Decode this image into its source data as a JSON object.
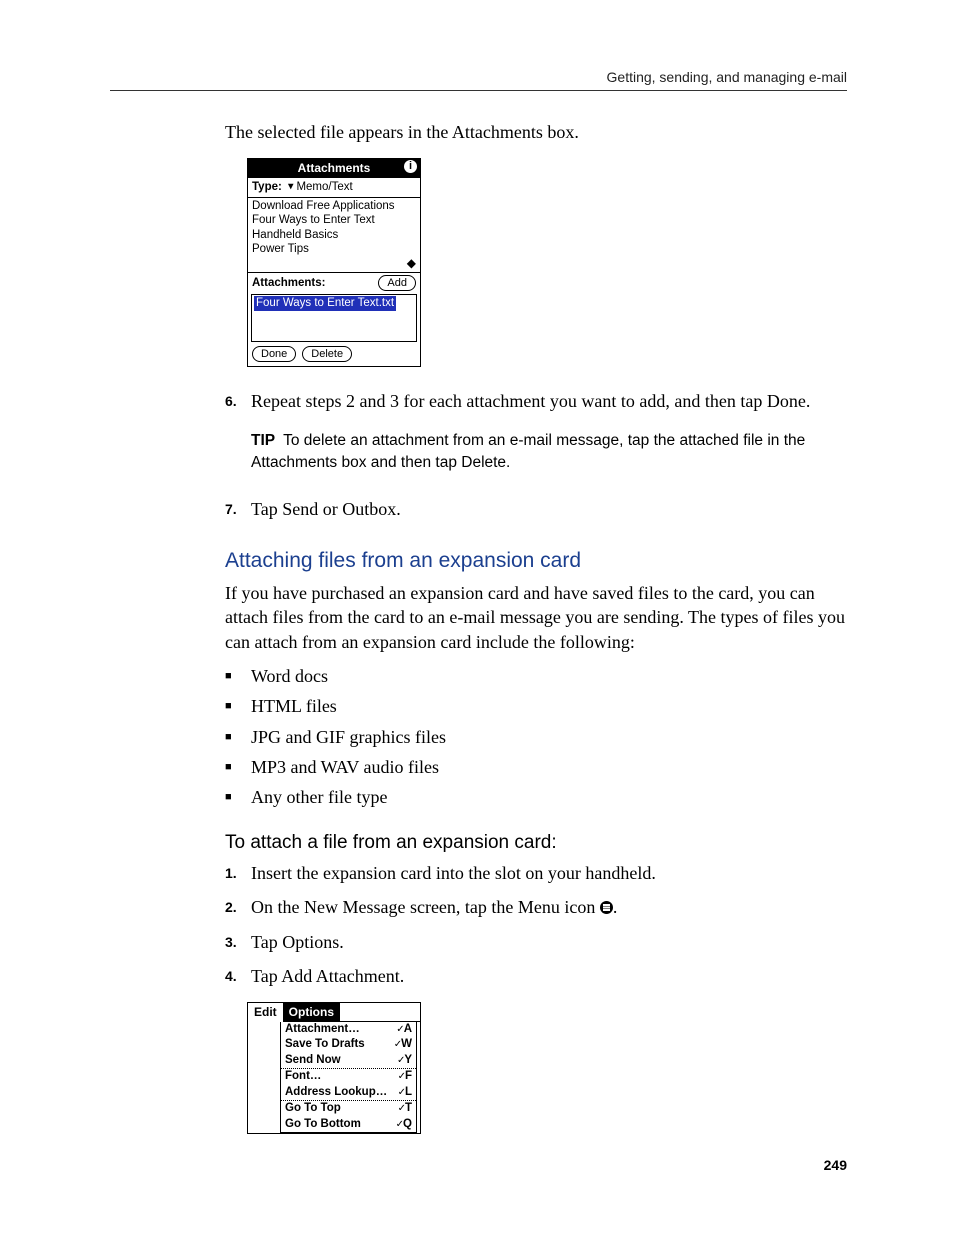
{
  "header": "Getting, sending, and managing e-mail",
  "page_number": "249",
  "intro_line": "The selected file appears in the Attachments box.",
  "screenshot1": {
    "title": "Attachments",
    "type_label": "Type:",
    "type_value": "Memo/Text",
    "items": [
      "Download Free Applications",
      "Four Ways to Enter Text",
      "Handheld Basics",
      "Power Tips"
    ],
    "attachments_label": "Attachments:",
    "add_btn": "Add",
    "selected_file": "Four Ways to Enter Text.txt",
    "done_btn": "Done",
    "delete_btn": "Delete"
  },
  "step6": {
    "num": "6.",
    "text": "Repeat steps 2 and 3 for each attachment you want to add, and then tap Done."
  },
  "tip": {
    "label": "TIP",
    "text": "To delete an attachment from an e-mail message, tap the attached file in the Attachments box and then tap Delete."
  },
  "step7": {
    "num": "7.",
    "text": "Tap Send or Outbox."
  },
  "section": {
    "heading": "Attaching files from an expansion card",
    "para": "If you have purchased an expansion card and have saved files to the card, you can attach files from the card to an e-mail message you are sending. The types of files you can attach from an expansion card include the following:",
    "bullets": [
      "Word docs",
      "HTML files",
      "JPG and GIF graphics files",
      "MP3 and WAV audio files",
      "Any other file type"
    ]
  },
  "procedure": {
    "heading": "To attach a file from an expansion card:",
    "steps": [
      {
        "num": "1.",
        "text": "Insert the expansion card into the slot on your handheld."
      },
      {
        "num": "2.",
        "pre": "On the New Message screen, tap the Menu icon ",
        "post": "."
      },
      {
        "num": "3.",
        "text": "Tap Options."
      },
      {
        "num": "4.",
        "text": "Tap Add Attachment."
      }
    ]
  },
  "screenshot2": {
    "tab_inactive": "Edit",
    "tab_active": "Options",
    "groups": [
      [
        {
          "label": "Attachment…",
          "sc": "A"
        },
        {
          "label": "Save To Drafts",
          "sc": "W"
        },
        {
          "label": "Send Now",
          "sc": "Y"
        }
      ],
      [
        {
          "label": "Font…",
          "sc": "F"
        },
        {
          "label": "Address Lookup…",
          "sc": "L"
        }
      ],
      [
        {
          "label": "Go To Top",
          "sc": "T"
        },
        {
          "label": "Go To Bottom",
          "sc": "Q"
        }
      ]
    ]
  }
}
